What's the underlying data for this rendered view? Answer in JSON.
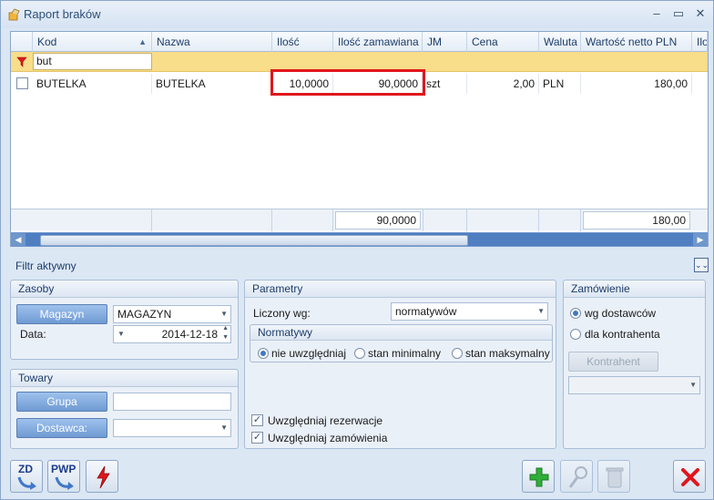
{
  "window": {
    "title": "Raport braków",
    "min": "–",
    "max": "▭",
    "close": "✕"
  },
  "grid": {
    "columns": [
      "Kod",
      "Nazwa",
      "Ilość",
      "Ilość zamawiana",
      "JM",
      "Cena",
      "Waluta",
      "Wartość netto PLN",
      "Ilo"
    ],
    "sort_indicator": "▲",
    "filter_value": "but",
    "rows": [
      {
        "kod": "BUTELKA",
        "nazwa": "BUTELKA",
        "ilosc": "10,0000",
        "ilosc_zam": "90,0000",
        "jm": "szt",
        "cena": "2,00",
        "waluta": "PLN",
        "wartosc": "180,00"
      }
    ],
    "footer": {
      "ilosc_zam": "90,0000",
      "wartosc": "180,00"
    }
  },
  "filter_bar": {
    "label": "Filtr aktywny",
    "toggle": "⌄⌄"
  },
  "zasoby": {
    "title": "Zasoby",
    "magazyn_button": "Magazyn",
    "magazyn_value": "MAGAZYN",
    "data_label": "Data:",
    "data_value": "2014-12-18"
  },
  "towary": {
    "title": "Towary",
    "grupa_button": "Grupa",
    "dostawca_button": "Dostawca:"
  },
  "parametry": {
    "title": "Parametry",
    "liczony_label": "Liczony wg:",
    "liczony_value": "normatywów",
    "normatywy_title": "Normatywy",
    "options": [
      "nie uwzględniaj",
      "stan minimalny",
      "stan maksymalny"
    ],
    "checks": [
      "Uwzględniaj rezerwacje",
      "Uwzględniaj zamówienia"
    ]
  },
  "zamowienie": {
    "title": "Zamówienie",
    "options": [
      "wg dostawców",
      "dla kontrahenta"
    ],
    "kontrahent_button": "Kontrahent"
  },
  "toolbar": {
    "zd_label": "ZD",
    "pwp_label": "PWP"
  },
  "colors": {
    "accent": "#3f78c8",
    "highlight": "#e0161d",
    "filter_row": "#f8dd8a"
  }
}
